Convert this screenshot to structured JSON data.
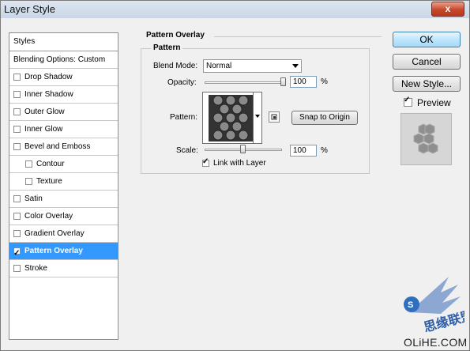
{
  "window": {
    "title": "Layer Style",
    "close_glyph": "x"
  },
  "left_panel": {
    "header": "Styles",
    "blending_options": "Blending Options: Custom",
    "items": [
      {
        "label": "Drop Shadow",
        "checked": false,
        "selected": false,
        "indent": false
      },
      {
        "label": "Inner Shadow",
        "checked": false,
        "selected": false,
        "indent": false
      },
      {
        "label": "Outer Glow",
        "checked": false,
        "selected": false,
        "indent": false
      },
      {
        "label": "Inner Glow",
        "checked": false,
        "selected": false,
        "indent": false
      },
      {
        "label": "Bevel and Emboss",
        "checked": false,
        "selected": false,
        "indent": false
      },
      {
        "label": "Contour",
        "checked": false,
        "selected": false,
        "indent": true
      },
      {
        "label": "Texture",
        "checked": false,
        "selected": false,
        "indent": true
      },
      {
        "label": "Satin",
        "checked": false,
        "selected": false,
        "indent": false
      },
      {
        "label": "Color Overlay",
        "checked": false,
        "selected": false,
        "indent": false
      },
      {
        "label": "Gradient Overlay",
        "checked": false,
        "selected": false,
        "indent": false
      },
      {
        "label": "Pattern Overlay",
        "checked": true,
        "selected": true,
        "indent": false
      },
      {
        "label": "Stroke",
        "checked": false,
        "selected": false,
        "indent": false
      }
    ]
  },
  "panel": {
    "title": "Pattern Overlay",
    "group_title": "Pattern",
    "blend_mode_label": "Blend Mode:",
    "blend_mode_value": "Normal",
    "opacity_label": "Opacity:",
    "opacity_value": "100",
    "opacity_fraction": 1.0,
    "pattern_label": "Pattern:",
    "snap_button": "Snap to Origin",
    "scale_label": "Scale:",
    "scale_value": "100",
    "scale_fraction": 0.5,
    "percent": "%",
    "link_label": "Link with Layer",
    "link_checked": true
  },
  "buttons": {
    "ok": "OK",
    "cancel": "Cancel",
    "new_style": "New Style...",
    "preview_label": "Preview",
    "preview_checked": true
  },
  "watermark": {
    "text": "OLiHE.COM",
    "logo_text": "思缘联盟"
  },
  "colors": {
    "selection": "#3399ff",
    "titlebar": "#c9d6e6",
    "close": "#c8472b"
  }
}
